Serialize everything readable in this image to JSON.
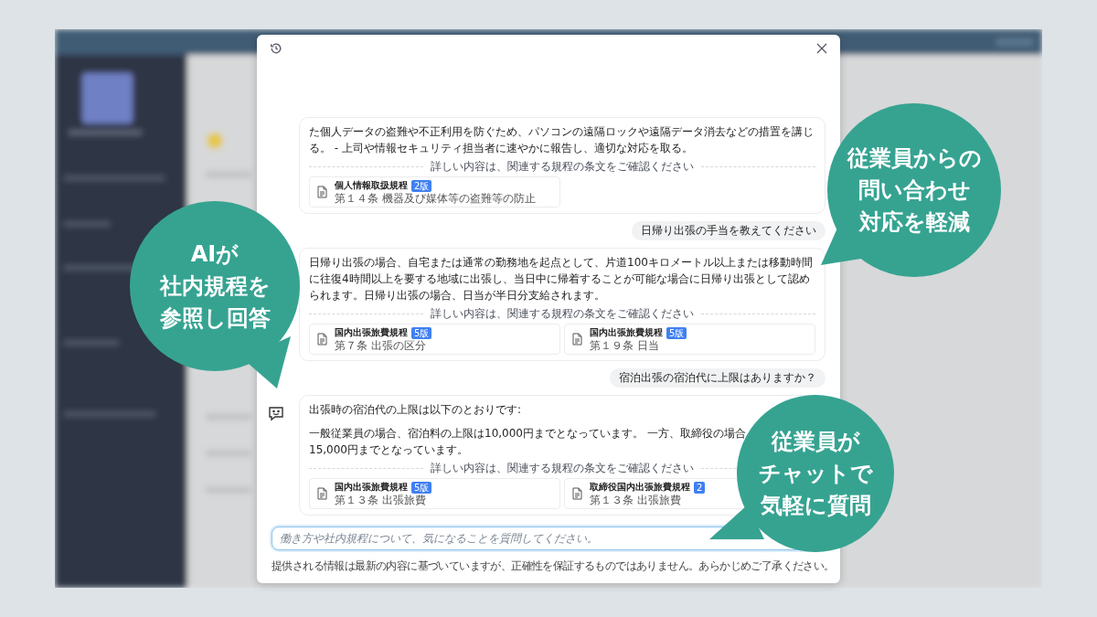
{
  "dialog": {
    "messages": [
      {
        "kind": "answer",
        "avatar": false,
        "paragraphs": [
          [
            "た個人データの盗難や不正利用を防ぐため、パソコンの遠隔ロックや遠隔データ消去などの措置を講じる。 - 上司や情報セキュリティ担当者に速やかに報告し、適切な対応を取る。"
          ]
        ],
        "reference_note": "詳しい内容は、関連する規程の条文をご確認ください",
        "references": [
          {
            "title": "個人情報取扱規程",
            "badge": "2版",
            "article": "第１４条 機器及び媒体等の盗難等の防止"
          }
        ]
      },
      {
        "kind": "question",
        "text": "日帰り出張の手当を教えてください"
      },
      {
        "kind": "answer",
        "avatar": false,
        "paragraphs": [
          [
            "日帰り出張の場合、自宅または通常の勤務地を起点として、片道100キロメートル以上または移動時間に往復4時間以上を要する地域に出張し、当日中に帰着することが可能な場合に日帰り出張として認められます。日帰り出張の場合、日当が半日分支給されます。"
          ]
        ],
        "reference_note": "詳しい内容は、関連する規程の条文をご確認ください",
        "references": [
          {
            "title": "国内出張旅費規程",
            "badge": "5版",
            "article": "第７条 出張の区分"
          },
          {
            "title": "国内出張旅費規程",
            "badge": "5版",
            "article": "第１９条 日当"
          }
        ]
      },
      {
        "kind": "question",
        "text": "宿泊出張の宿泊代に上限はありますか？"
      },
      {
        "kind": "answer",
        "avatar": true,
        "paragraphs": [
          [
            "出張時の宿泊代の上限は以下のとおりです:"
          ],
          [
            "一般従業員の場合、宿泊料の上限は10,000円までとなっています。 一方、取締役の場合",
            "15,000円までとなっています。"
          ]
        ],
        "reference_note": "詳しい内容は、関連する規程の条文をご確認ください",
        "references": [
          {
            "title": "国内出張旅費規程",
            "badge": "5版",
            "article": "第１３条 出張旅費"
          },
          {
            "title": "取締役国内出張旅費規程",
            "badge": "2",
            "article": "第１３条 出張旅費"
          }
        ]
      }
    ],
    "input": {
      "placeholder": "働き方や社内規程について、気になることを質問してください。"
    },
    "disclaimer": "提供される情報は最新の内容に基づいていますが、正確性を保証するものではありません。あらかじめご了承ください。"
  },
  "callouts": [
    {
      "lines": [
        "AIが",
        "社内規程を",
        "参照し回答"
      ]
    },
    {
      "lines": [
        "従業員からの",
        "問い合わせ",
        "対応を軽減"
      ]
    },
    {
      "lines": [
        "従業員が",
        "チャットで",
        "気軽に質問"
      ]
    }
  ]
}
